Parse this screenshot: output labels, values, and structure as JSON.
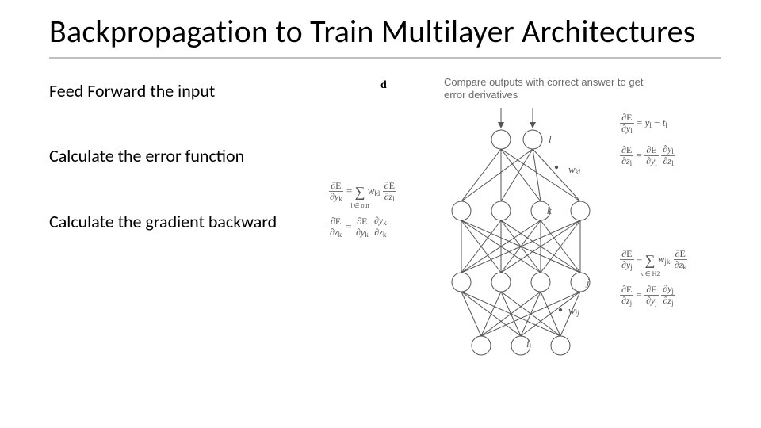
{
  "title": "Backpropagation to Train Multilayer Architectures",
  "steps": {
    "s1": "Feed Forward the input",
    "s2": "Calculate the error function",
    "s3": "Calculate the gradient backward"
  },
  "figure": {
    "panel_label": "d",
    "caption": "Compare outputs with correct answer to get error derivatives",
    "labels": {
      "l": "l",
      "k": "k",
      "j": "j",
      "i": "i",
      "wkl": "w",
      "wkl_sub": "kl",
      "wij": "w",
      "wij_sub": "ij"
    },
    "eq_out": {
      "lhs_num": "∂E",
      "lhs_den_var": "∂y",
      "lhs_den_sub": "l",
      "eq": "=",
      "rhs1_var": "y",
      "rhs1_sub": "l",
      "minus": "−",
      "rhs2_var": "t",
      "rhs2_sub": "l"
    },
    "eq_zl": {
      "a_num": "∂E",
      "a_den_var": "∂z",
      "a_den_sub": "l",
      "eq": "=",
      "b_num": "∂E",
      "b_den_var": "∂y",
      "b_den_sub": "l",
      "c_num_var": "∂y",
      "c_num_sub": "l",
      "c_den_var": "∂z",
      "c_den_sub": "l"
    },
    "eq_yj": {
      "a_num": "∂E",
      "a_den_var": "∂y",
      "a_den_sub": "j",
      "eq": "=",
      "sum_lim": "k ∈ H2",
      "w_var": "w",
      "w_sub": "jk",
      "b_num": "∂E",
      "b_den_var": "∂z",
      "b_den_sub": "k"
    },
    "eq_zj": {
      "a_num": "∂E",
      "a_den_var": "∂z",
      "a_den_sub": "j",
      "eq": "=",
      "b_num": "∂E",
      "b_den_var": "∂y",
      "b_den_sub": "j",
      "c_num_var": "∂y",
      "c_num_sub": "j",
      "c_den_var": "∂z",
      "c_den_sub": "j"
    },
    "eq_yk": {
      "a_num": "∂E",
      "a_den_var": "∂y",
      "a_den_sub": "k",
      "eq": "=",
      "sum_lim": "l ∈ out",
      "w_var": "w",
      "w_sub": "kl",
      "b_num": "∂E",
      "b_den_var": "∂z",
      "b_den_sub": "l"
    },
    "eq_zk": {
      "a_num": "∂E",
      "a_den_var": "∂z",
      "a_den_sub": "k",
      "eq": "=",
      "b_num": "∂E",
      "b_den_var": "∂y",
      "b_den_sub": "k",
      "c_num_var": "∂y",
      "c_num_sub": "k",
      "c_den_var": "∂z",
      "c_den_sub": "k"
    }
  }
}
